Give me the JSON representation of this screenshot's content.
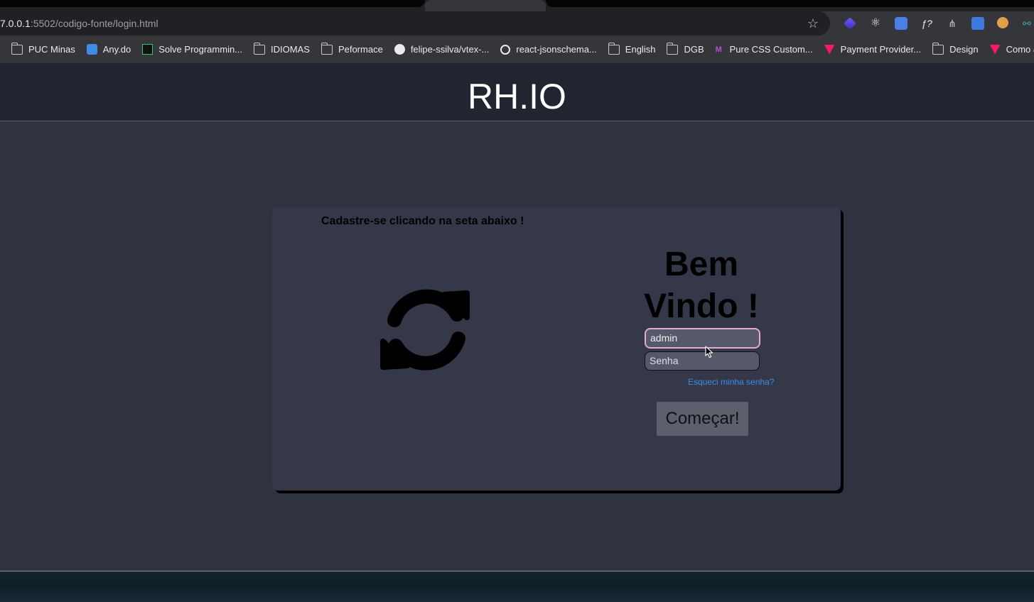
{
  "browser": {
    "url_host": "7.0.0.1",
    "url_path": ":5502/codigo-fonte/login.html",
    "bookmarks": [
      {
        "label": "PUC Minas",
        "icon": "folder-icon"
      },
      {
        "label": "Any.do",
        "icon": "anydo-icon"
      },
      {
        "label": "Solve Programmin...",
        "icon": "hackerrank-icon"
      },
      {
        "label": "IDIOMAS",
        "icon": "folder-icon"
      },
      {
        "label": "Peformace",
        "icon": "folder-icon"
      },
      {
        "label": "felipe-ssilva/vtex-...",
        "icon": "github-icon"
      },
      {
        "label": "react-jsonschema...",
        "icon": "globe-icon"
      },
      {
        "label": "English",
        "icon": "folder-icon"
      },
      {
        "label": "DGB",
        "icon": "folder-icon"
      },
      {
        "label": "Pure CSS Custom...",
        "icon": "site-icon"
      },
      {
        "label": "Payment Provider...",
        "icon": "vtex-icon"
      },
      {
        "label": "Design",
        "icon": "folder-icon"
      },
      {
        "label": "Como acha",
        "icon": "vtex-icon"
      }
    ]
  },
  "header": {
    "brand": "RH.IO"
  },
  "login": {
    "hint": "Cadastre-se clicando na seta abaixo !",
    "welcome_line1": "Bem",
    "welcome_line2": "Vindo !",
    "username_value": "admin",
    "password_placeholder": "Senha",
    "forgot_link": "Esqueci minha senha?",
    "submit_label": "Começar!"
  },
  "colors": {
    "header_bg": "#212530",
    "page_bg": "#2f323f",
    "card_bg": "#353848",
    "link": "#3a8de8",
    "focus_border": "#e8a8d8"
  }
}
